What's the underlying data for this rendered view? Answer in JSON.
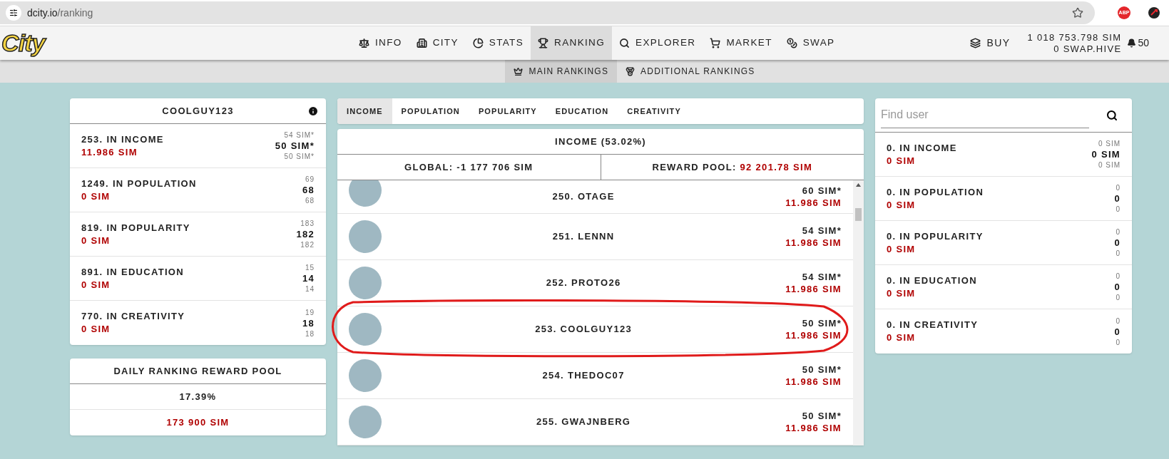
{
  "browser": {
    "url_domain": "dcity.io",
    "url_path": "/ranking",
    "extension_badge": "ABP"
  },
  "logo": "City",
  "nav": {
    "items": [
      {
        "label": "INFO",
        "selected": false
      },
      {
        "label": "CITY",
        "selected": false
      },
      {
        "label": "STATS",
        "selected": false
      },
      {
        "label": "RANKING",
        "selected": true
      },
      {
        "label": "EXPLORER",
        "selected": false
      },
      {
        "label": "MARKET",
        "selected": false
      },
      {
        "label": "SWAP",
        "selected": false
      }
    ],
    "buy": "BUY",
    "balance": [
      "1 018 753.798 SIM",
      "0 SWAP.HIVE"
    ],
    "notifications": "50"
  },
  "subnav": [
    {
      "label": "MAIN RANKINGS",
      "selected": true
    },
    {
      "label": "ADDITIONAL RANKINGS",
      "selected": false
    }
  ],
  "user_card": {
    "title": "COOLGUY123",
    "rows": [
      {
        "rank": "253. IN INCOME",
        "reward": "11.986 SIM",
        "above": "54 SIM*",
        "value": "50 SIM*",
        "below": "50 SIM*"
      },
      {
        "rank": "1249. IN POPULATION",
        "reward": "0 SIM",
        "above": "69",
        "value": "68",
        "below": "68"
      },
      {
        "rank": "819. IN POPULARITY",
        "reward": "0 SIM",
        "above": "183",
        "value": "182",
        "below": "182"
      },
      {
        "rank": "891. IN EDUCATION",
        "reward": "0 SIM",
        "above": "15",
        "value": "14",
        "below": "14"
      },
      {
        "rank": "770. IN CREATIVITY",
        "reward": "0 SIM",
        "above": "19",
        "value": "18",
        "below": "18"
      }
    ]
  },
  "reward_pool_card": {
    "title": "DAILY RANKING REWARD POOL",
    "percent": "17.39%",
    "amount": "173 900 SIM"
  },
  "category_tabs": [
    {
      "label": "INCOME",
      "selected": true
    },
    {
      "label": "POPULATION",
      "selected": false
    },
    {
      "label": "POPULARITY",
      "selected": false
    },
    {
      "label": "EDUCATION",
      "selected": false
    },
    {
      "label": "CREATIVITY",
      "selected": false
    }
  ],
  "ranking": {
    "title": "INCOME (53.02%)",
    "global": "GLOBAL: -1 177 706 SIM",
    "reward_pool_label": "REWARD POOL:",
    "reward_pool_value": "92 201.78 SIM",
    "rows": [
      {
        "name": "250. OTAGE",
        "score": "60 SIM*",
        "reward": "11.986 SIM",
        "circled": false
      },
      {
        "name": "251. LENNN",
        "score": "54 SIM*",
        "reward": "11.986 SIM",
        "circled": false
      },
      {
        "name": "252. PROTO26",
        "score": "54 SIM*",
        "reward": "11.986 SIM",
        "circled": false
      },
      {
        "name": "253. COOLGUY123",
        "score": "50 SIM*",
        "reward": "11.986 SIM",
        "circled": true
      },
      {
        "name": "254. THEDOC07",
        "score": "50 SIM*",
        "reward": "11.986 SIM",
        "circled": false
      },
      {
        "name": "255. GWAJNBERG",
        "score": "50 SIM*",
        "reward": "11.986 SIM",
        "circled": false
      }
    ]
  },
  "search": {
    "placeholder": "Find user"
  },
  "lookup_rows": [
    {
      "rank": "0. IN INCOME",
      "reward": "0 SIM",
      "above": "0 SIM",
      "value": "0 SIM",
      "below": "0 SIM"
    },
    {
      "rank": "0. IN POPULATION",
      "reward": "0 SIM",
      "above": "0",
      "value": "0",
      "below": "0"
    },
    {
      "rank": "0. IN POPULARITY",
      "reward": "0 SIM",
      "above": "0",
      "value": "0",
      "below": "0"
    },
    {
      "rank": "0. IN EDUCATION",
      "reward": "0 SIM",
      "above": "0",
      "value": "0",
      "below": "0"
    },
    {
      "rank": "0. IN CREATIVITY",
      "reward": "0 SIM",
      "above": "0",
      "value": "0",
      "below": "0"
    }
  ]
}
